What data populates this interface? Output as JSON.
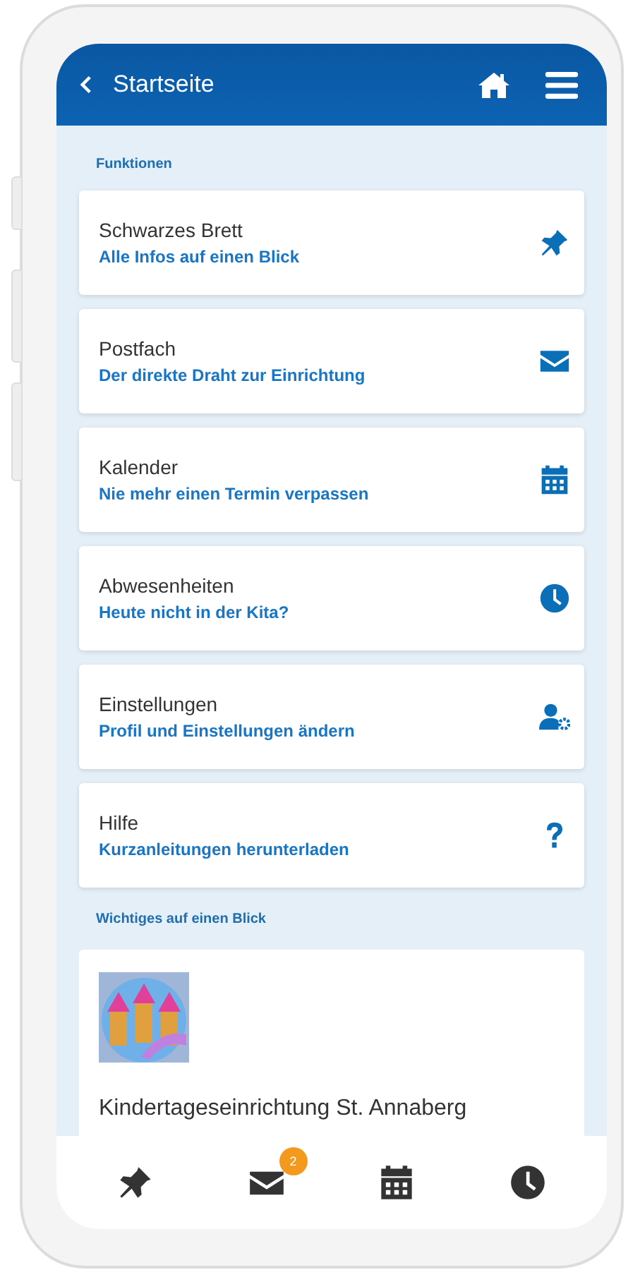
{
  "header": {
    "back_label": "Startseite"
  },
  "functions_heading": "Funktionen",
  "functions": [
    {
      "title": "Schwarzes Brett",
      "subtitle": "Alle Infos auf einen Blick"
    },
    {
      "title": "Postfach",
      "subtitle": "Der direkte Draht zur Einrichtung"
    },
    {
      "title": "Kalender",
      "subtitle": "Nie mehr einen Termin verpassen"
    },
    {
      "title": "Abwesenheiten",
      "subtitle": "Heute nicht in der Kita?"
    },
    {
      "title": "Einstellungen",
      "subtitle": "Profil und Einstellungen ändern"
    },
    {
      "title": "Hilfe",
      "subtitle": "Kurzanleitungen herunterladen"
    }
  ],
  "overview_heading": "Wichtiges auf einen Blick",
  "institution": {
    "name": "Kindertageseinrichtung St. Annaberg"
  },
  "bottom_nav": {
    "mail_badge": "2"
  }
}
